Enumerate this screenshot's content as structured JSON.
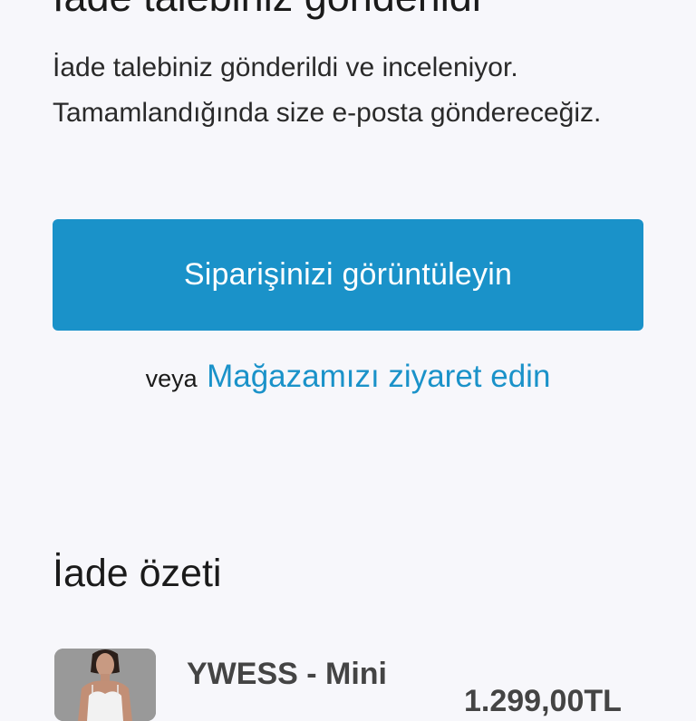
{
  "page": {
    "title": "İade talebiniz gönderildi",
    "message": "İade talebiniz gönderildi ve inceleniyor. Tamamlandığında size e-posta göndereceğiz."
  },
  "actions": {
    "view_order_label": "Siparişinizi görüntüleyin",
    "or_text": "veya",
    "visit_store_label": "Mağazamızı ziyaret edin"
  },
  "summary": {
    "heading": "İade özeti",
    "items": [
      {
        "name": "YWESS - Mini",
        "price": "1.299,00TL"
      }
    ]
  },
  "colors": {
    "background": "#f7f7fb",
    "accent": "#1a92c9",
    "text": "#1f1f1f"
  }
}
